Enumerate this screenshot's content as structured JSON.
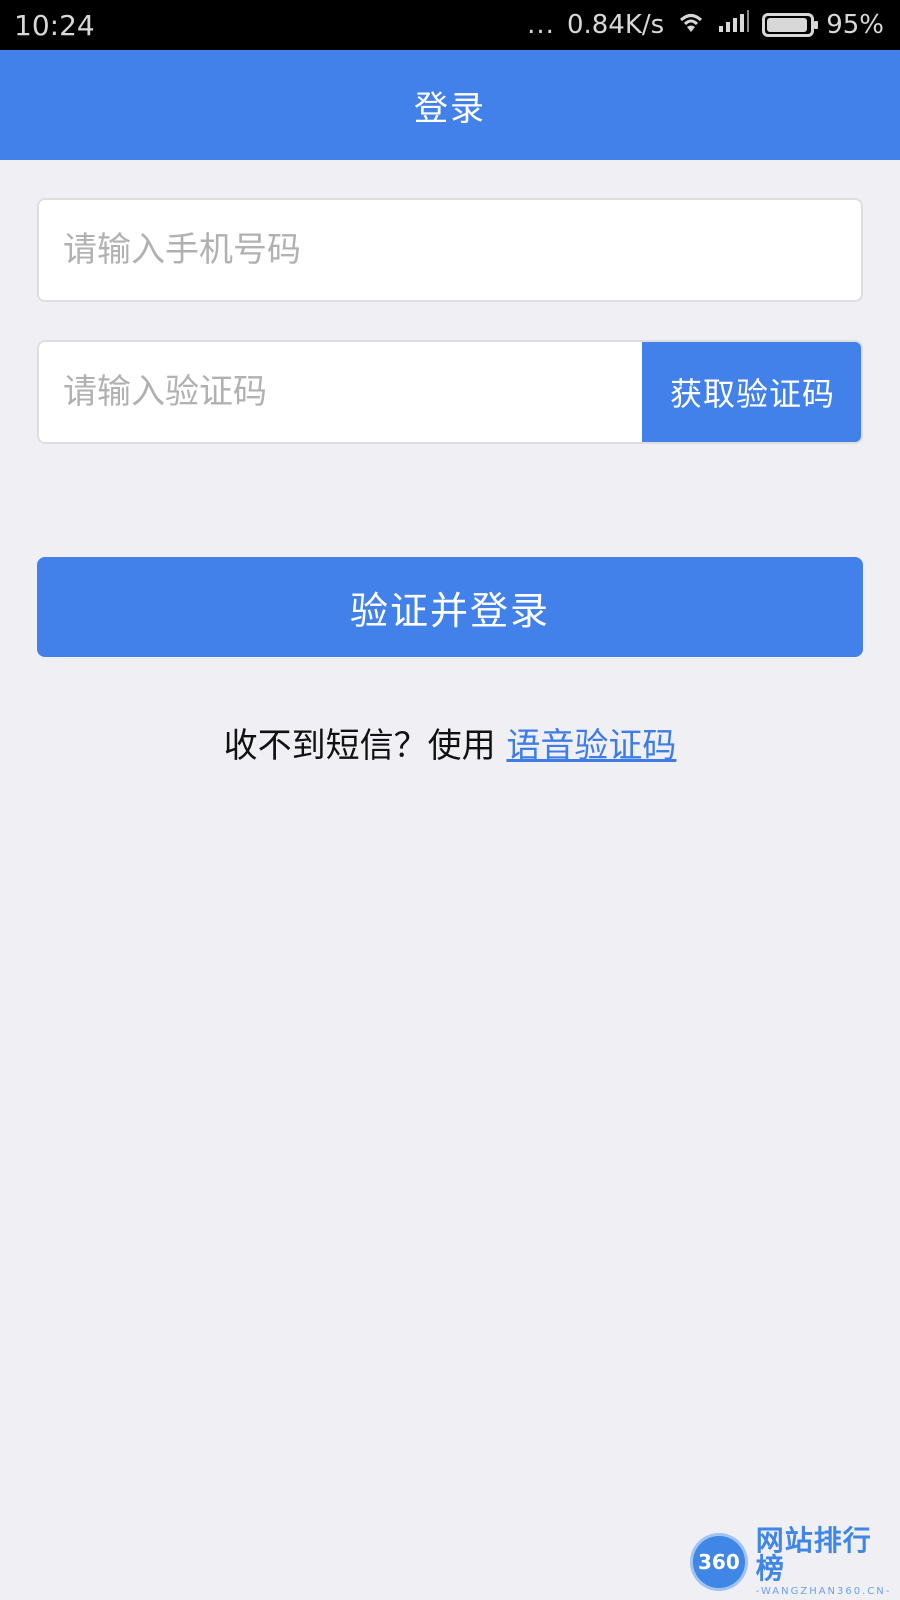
{
  "status_bar": {
    "time": "10:24",
    "dots": "...",
    "network_speed": "0.84K/s",
    "wifi_icon": "wifi-icon",
    "signal_icon": "signal-icon",
    "battery_percent": "95%",
    "battery_level": 0.95
  },
  "header": {
    "title": "登录"
  },
  "form": {
    "phone_placeholder": "请输入手机号码",
    "phone_value": "",
    "code_placeholder": "请输入验证码",
    "code_value": "",
    "get_code_label": "获取验证码",
    "login_label": "验证并登录",
    "sms_help_text": "收不到短信？使用 ",
    "voice_link_label": "语音验证码"
  },
  "watermark": {
    "logo_text": "360",
    "main": "网站排行榜",
    "sub": "-WANGZHAN360.CN-"
  },
  "colors": {
    "primary": "#4281ea",
    "background": "#efeff4",
    "link": "#3f7de6"
  }
}
